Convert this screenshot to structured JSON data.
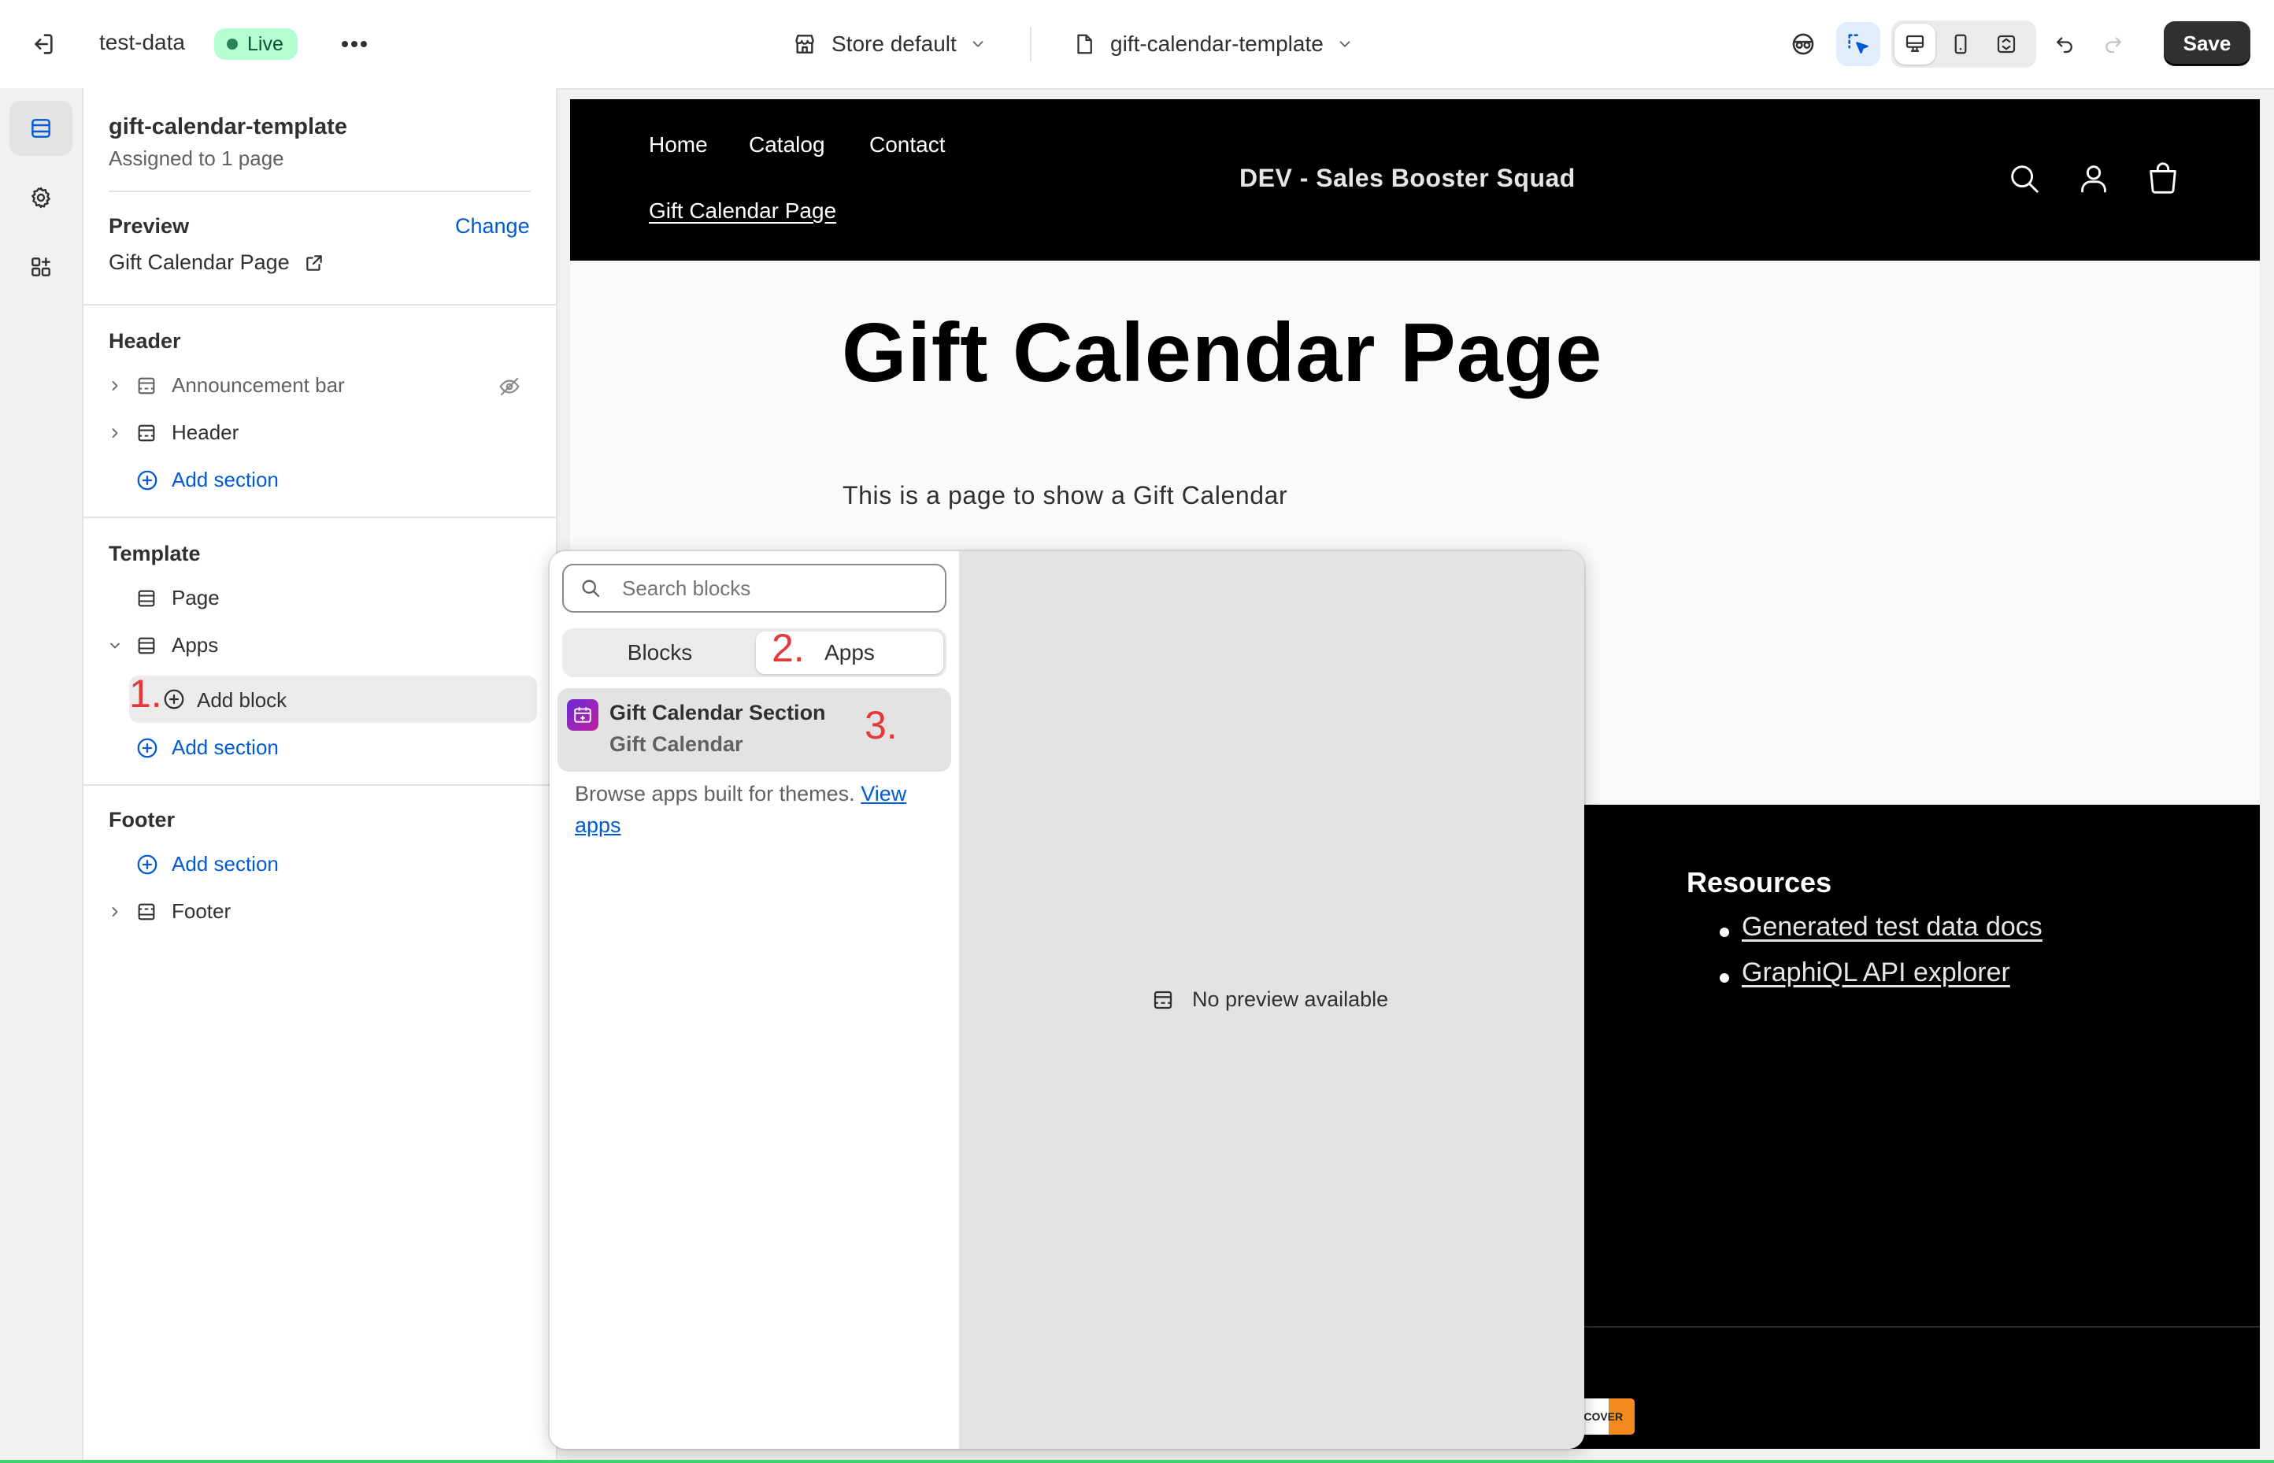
{
  "topbar": {
    "store_name": "test-data",
    "status_badge": "Live",
    "store_selector": "Store default",
    "template_selector": "gift-calendar-template",
    "save_label": "Save"
  },
  "panel": {
    "template_name": "gift-calendar-template",
    "assigned": "Assigned to 1 page",
    "preview_label": "Preview",
    "change_link": "Change",
    "preview_page": "Gift Calendar Page",
    "groups": {
      "header": {
        "title": "Header",
        "items": [
          "Announcement bar",
          "Header"
        ],
        "add_section": "Add section"
      },
      "template": {
        "title": "Template",
        "items": [
          "Page",
          "Apps"
        ],
        "add_block": "Add block",
        "add_section": "Add section"
      },
      "footer": {
        "title": "Footer",
        "add_section": "Add section",
        "items": [
          "Footer"
        ]
      }
    }
  },
  "store": {
    "nav": [
      "Home",
      "Catalog",
      "Contact"
    ],
    "nav_active": "Gift Calendar Page",
    "brand": "DEV - Sales Booster Squad",
    "page_title": "Gift Calendar Page",
    "page_body": "This is a page to show a Gift Calendar",
    "footer_heading": "Resources",
    "footer_links": [
      "Generated test data docs",
      "GraphiQL API explorer"
    ],
    "payment_badge": "DISCOVER"
  },
  "popover": {
    "search_placeholder": "Search blocks",
    "tabs": [
      "Blocks",
      "Apps"
    ],
    "active_tab": "Apps",
    "app_item": {
      "title": "Gift Calendar Section",
      "subtitle": "Gift Calendar"
    },
    "browse_text": "Browse apps built for themes.",
    "view_apps_link_1": "View",
    "view_apps_link_2": "apps",
    "no_preview": "No preview available"
  },
  "annotations": [
    "1.",
    "2.",
    "3."
  ],
  "colors": {
    "accent": "#005bd3",
    "live_bg": "#b4fed2",
    "annotation_red": "#e5383b",
    "store_black": "#000000"
  }
}
